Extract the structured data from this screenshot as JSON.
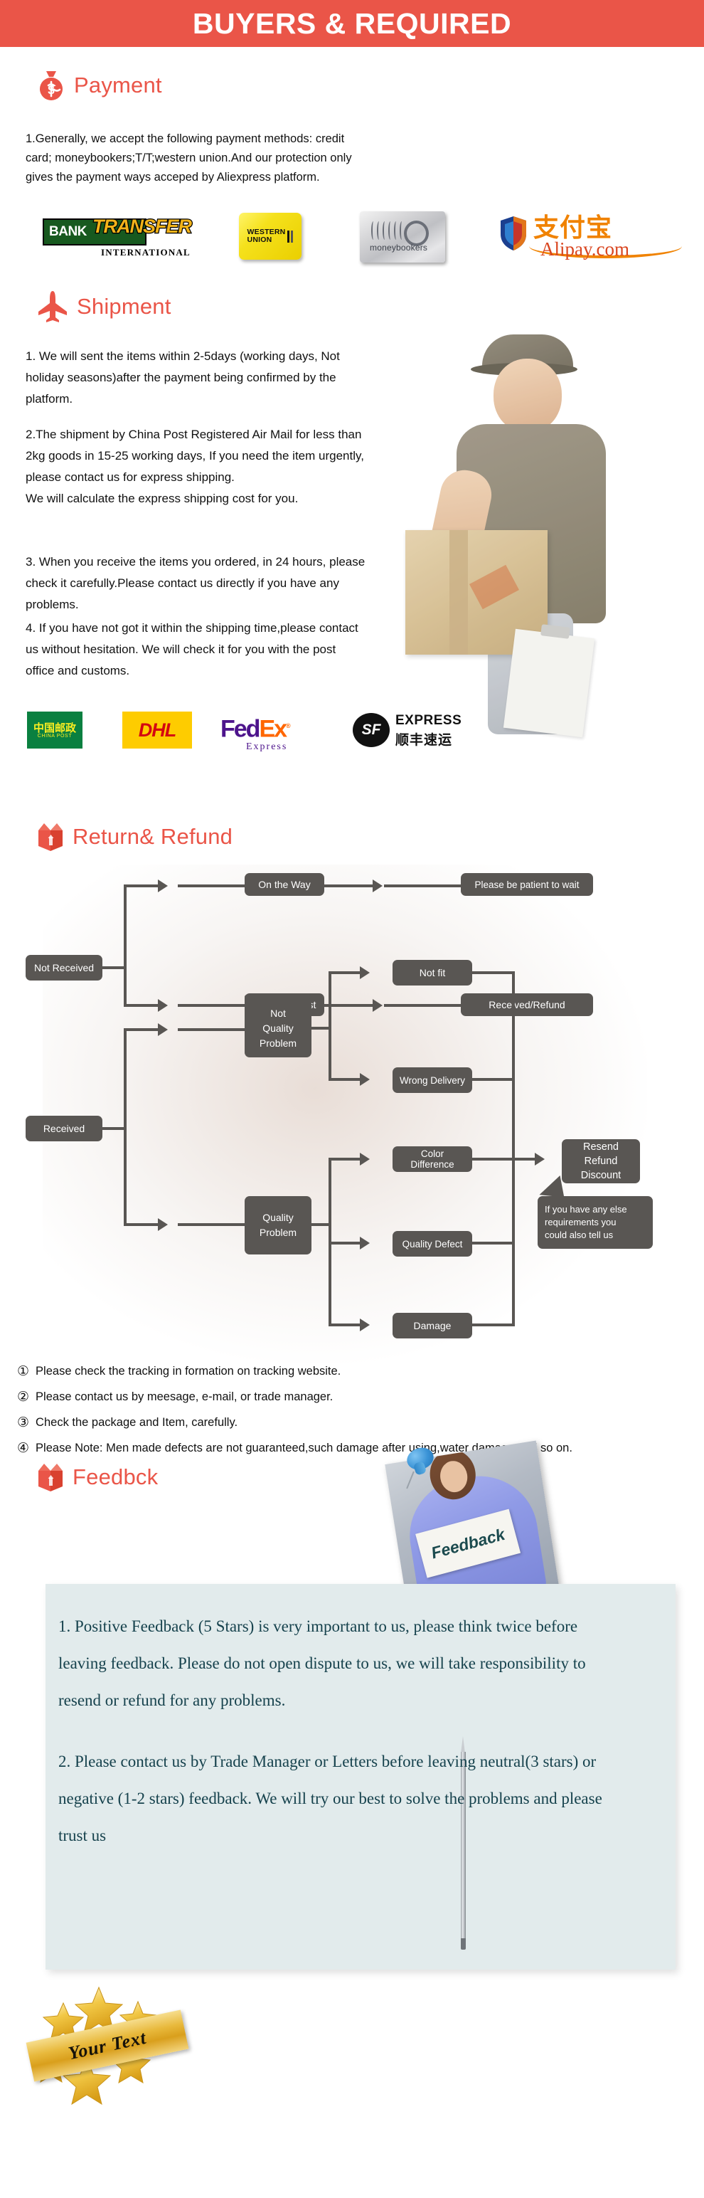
{
  "header": {
    "title": "BUYERS & REQUIRED",
    "bg_color": "#ea5548"
  },
  "sections": {
    "payment": {
      "icon": "money-bag-icon",
      "title": "Payment",
      "body": "1.Generally, we accept the following payment methods: credit card; moneybookers;T/T;western union.And our protection only gives the payment ways acceped by Aliexpress platform.",
      "logos": [
        {
          "name": "bank-transfer",
          "line1": "BANK",
          "line2": "TRANSFER",
          "line3": "INTERNATIONAL"
        },
        {
          "name": "western-union",
          "line1": "WESTERN",
          "line2": "UNION"
        },
        {
          "name": "moneybookers",
          "line1": "moneybookers"
        },
        {
          "name": "alipay",
          "line1": "支付宝",
          "line2": "Alipay.com"
        }
      ]
    },
    "shipment": {
      "icon": "airplane-icon",
      "title": "Shipment",
      "paragraphs": [
        "1. We will sent the items within 2-5days (working days, Not holiday seasons)after the payment being confirmed by the platform.",
        "2.The shipment by China Post Registered Air Mail for less than  2kg goods in 15-25 working days, If  you need the item urgently, please contact us for express shipping.\nWe will calculate the express shipping cost for you.",
        "3. When you receive the items you ordered, in 24 hours, please check it carefully.Please contact us directly if you have any problems.",
        "4. If you have not got it within the shipping time,please contact us without hesitation. We will check it for you with the post office and customs."
      ],
      "couriers": [
        {
          "name": "china-post",
          "cn": "中国邮政",
          "en": "CHINA POST"
        },
        {
          "name": "dhl",
          "text": "DHL"
        },
        {
          "name": "fedex",
          "text1": "Fed",
          "text2": "Ex",
          "sub": "Express"
        },
        {
          "name": "sf-express",
          "badge": "SF",
          "en": "EXPRESS",
          "cn": "顺丰速运"
        }
      ]
    },
    "return_refund": {
      "icon": "open-box-icon",
      "title": "Return& Refund",
      "flow": {
        "not_received": "Not Received",
        "on_the_way": "On the Way",
        "please_wait": "Please be patient to wait",
        "received_lost": "Received/Lost",
        "received_refund": "Received/Refund",
        "received": "Received",
        "not_quality_problem": "Not\nQuality\nProblem",
        "quality_problem": "Quality\nProblem",
        "not_fit": "Not fit",
        "wrong_delivery": "Wrong Delivery",
        "color_difference": "Color Difference",
        "quality_defect": "Quality Defect",
        "damage": "Damage",
        "resend_refund_discount": "Resend\nRefund\nDiscount",
        "callout": "If you have any else\nrequirements you\ncould also tell us"
      },
      "notes": [
        {
          "num": "①",
          "text": "Please check the tracking in formation on tracking website."
        },
        {
          "num": "②",
          "text": "Please contact us by meesage, e-mail, or trade manager."
        },
        {
          "num": "③",
          "text": "Check the package and Item, carefully."
        },
        {
          "num": "④",
          "text": "Please Note: Men made defects  are not guaranteed,such damage after using,water damage and so on."
        }
      ]
    },
    "feedback": {
      "icon": "open-box-icon",
      "title": "Feedbck",
      "photo_card_text": "Feedback",
      "paragraphs": [
        "1. Positive Feedback (5 Stars) is very important to us, please think twice before leaving feedback. Please do not open dispute to us,   we will take responsibility to resend or refund for any problems.",
        "2. Please contact us by Trade Manager or Letters before leaving neutral(3 stars) or negative (1-2 stars) feedback. We will try our best to solve the problems and please trust us"
      ],
      "badge_text": "Your Text"
    }
  },
  "colors": {
    "accent": "#ea5548",
    "flow_node": "#595653",
    "feedback_bg": "#e2ebec",
    "feedback_text": "#16424d"
  }
}
